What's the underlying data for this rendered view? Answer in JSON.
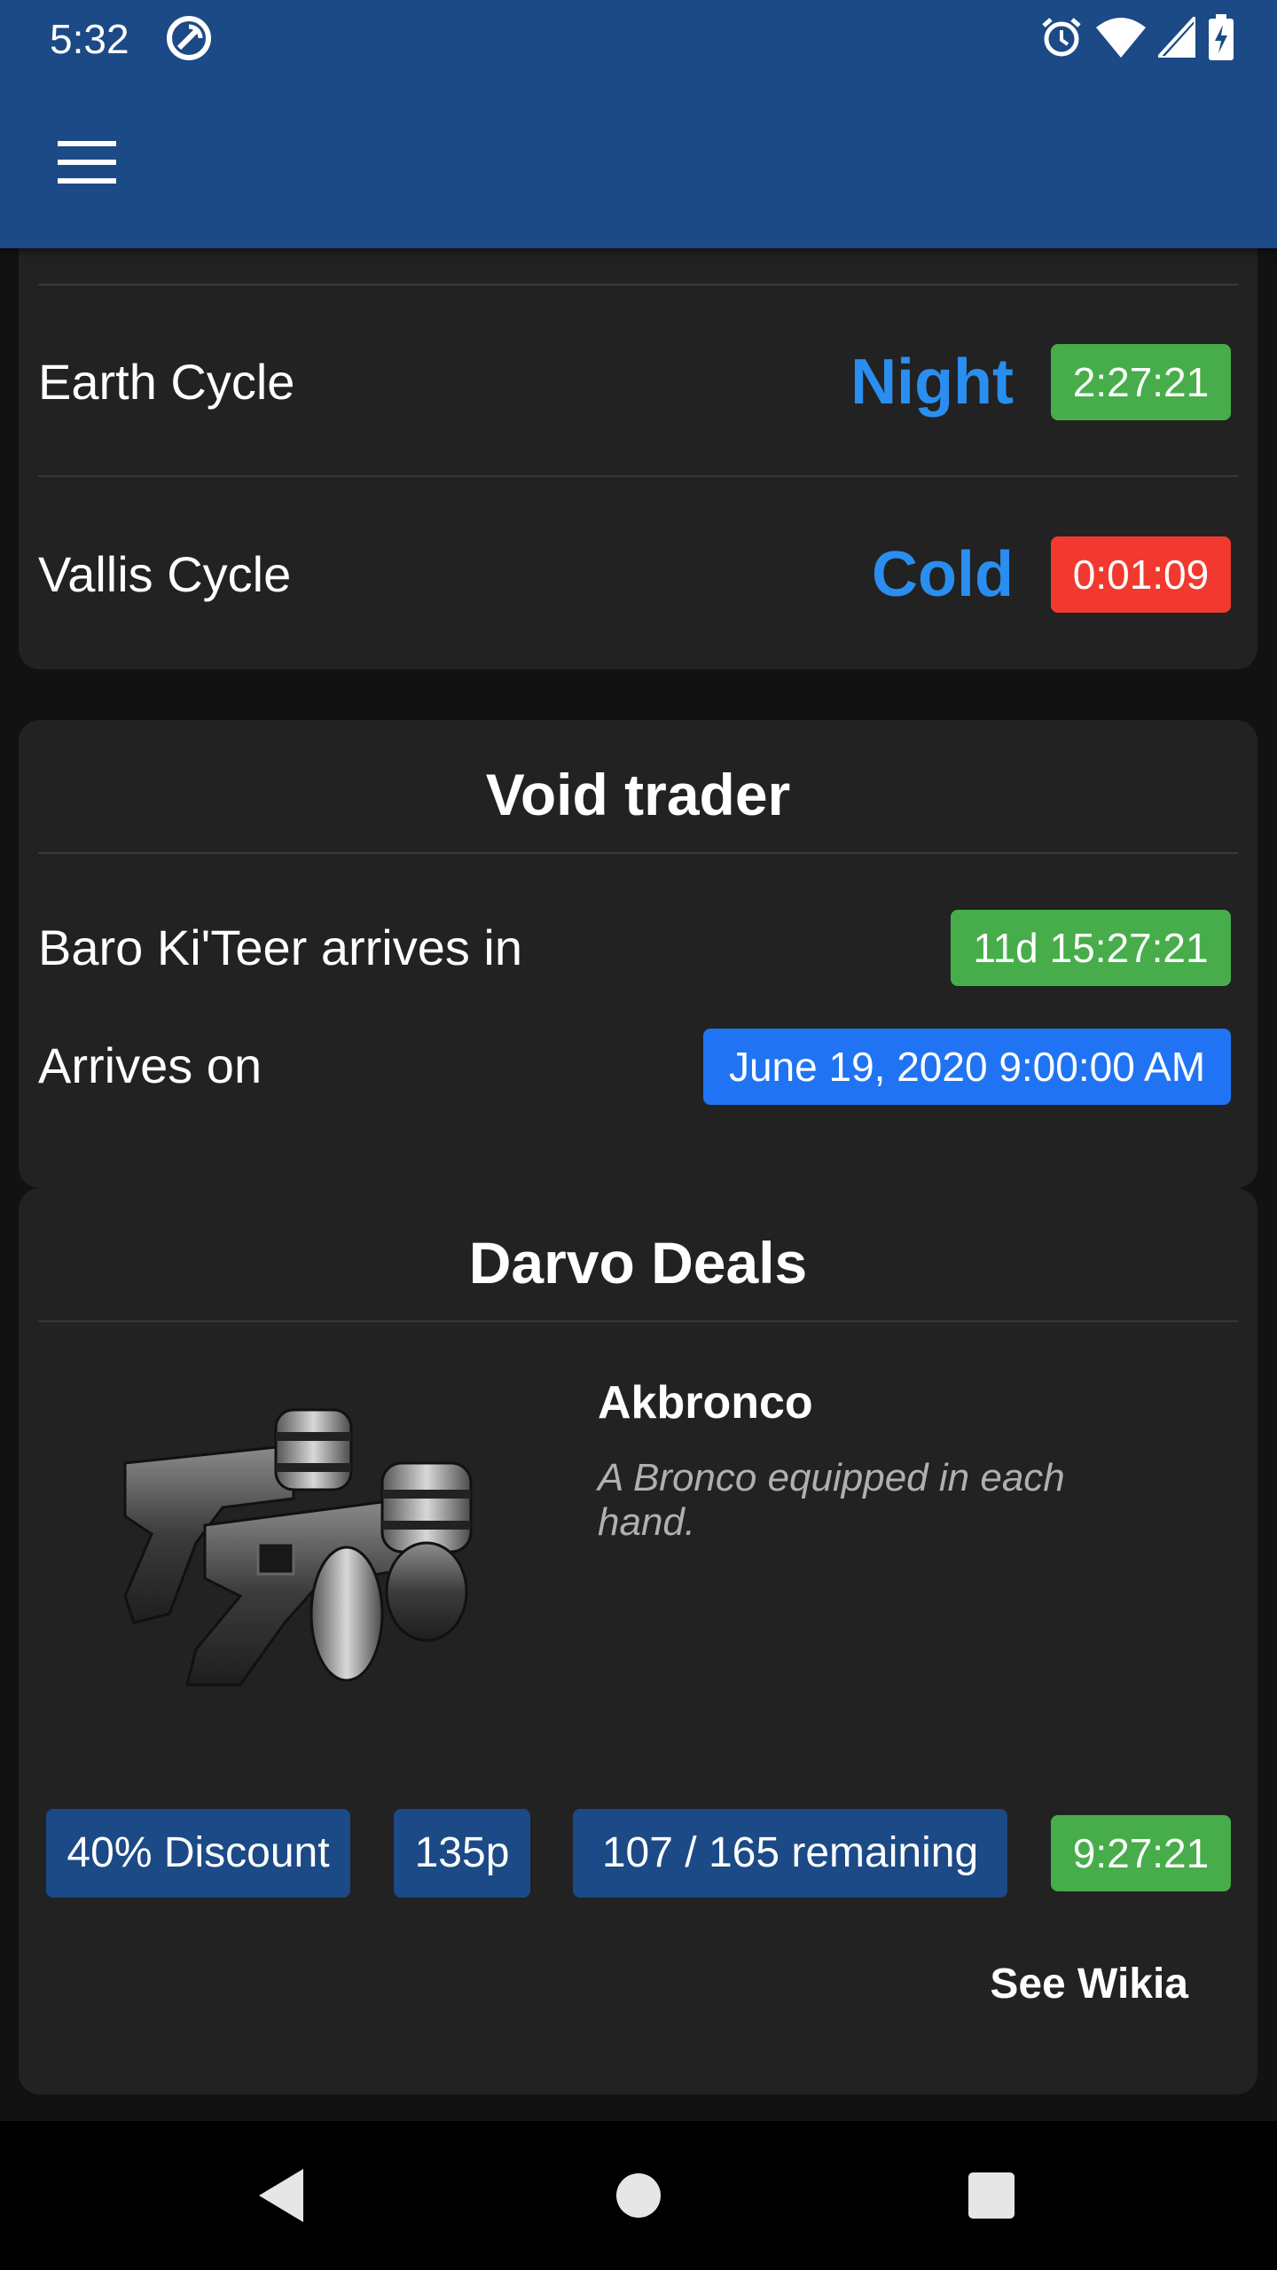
{
  "status_bar": {
    "time": "5:32",
    "icons": [
      "sync-icon",
      "alarm-icon",
      "wifi-icon",
      "cell-signal-icon",
      "battery-charging-icon"
    ]
  },
  "app_bar": {
    "menu_icon": "hamburger-menu-icon"
  },
  "cycles": [
    {
      "label": "Earth Cycle",
      "state": "Night",
      "timer": "2:27:21",
      "timer_color": "#47ad4a"
    },
    {
      "label": "Vallis Cycle",
      "state": "Cold",
      "timer": "0:01:09",
      "timer_color": "#f2392f"
    }
  ],
  "void_trader": {
    "title": "Void trader",
    "arrives_in_label": "Baro Ki'Teer arrives in",
    "arrives_in_value": "11d 15:27:21",
    "arrives_on_label": "Arrives on",
    "arrives_on_value": "June 19, 2020 9:00:00 AM"
  },
  "darvo_deals": {
    "title": "Darvo Deals",
    "item_name": "Akbronco",
    "item_description": "A Bronco equipped in each hand.",
    "discount": "40% Discount",
    "price": "135p",
    "remaining": "107 / 165 remaining",
    "timer": "9:27:21",
    "wikia_button": "See Wikia"
  },
  "colors": {
    "app_bar": "#1b4a86",
    "card": "#222222",
    "background": "#121212",
    "cycle_state": "#2a8ef0",
    "badge_green": "#47ad4a",
    "badge_red": "#f2392f",
    "badge_blue": "#2074f4",
    "badge_dark_blue": "#1b4a86"
  },
  "nav_bar": {
    "buttons": [
      "back-icon",
      "home-icon",
      "recents-icon"
    ]
  }
}
